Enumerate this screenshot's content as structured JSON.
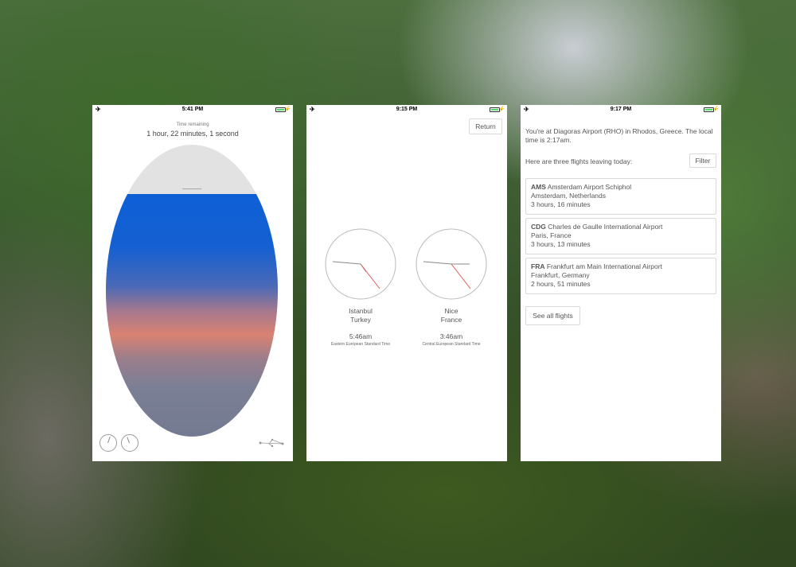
{
  "phone1": {
    "status_time": "5:41 PM",
    "time_remaining_label": "Time remaining",
    "time_remaining_value": "1 hour, 22 minutes, 1 second",
    "progress_fraction": 0.83,
    "icons": [
      "airplane-icon",
      "battery-icon",
      "clock-icon",
      "clock-icon",
      "network-icon"
    ]
  },
  "phone2": {
    "status_time": "9:15 PM",
    "return_label": "Return",
    "clocks": [
      {
        "city": "Istanbul",
        "country": "Turkey",
        "time": "5:46am",
        "timezone": "Eastern European Standard Time"
      },
      {
        "city": "Nice",
        "country": "France",
        "time": "3:46am",
        "timezone": "Central European Standard Time"
      }
    ]
  },
  "phone3": {
    "status_time": "9:17 PM",
    "intro": "You're at Diagoras Airport (RHO) in Rhodos, Greece. The local time is 2:17am.",
    "flights_label": "Here are three flights leaving today:",
    "filter_label": "Filter",
    "flights": [
      {
        "code": "AMS",
        "airport": "Amsterdam Airport Schiphol",
        "location": "Amsterdam, Netherlands",
        "duration": "3 hours, 16 minutes"
      },
      {
        "code": "CDG",
        "airport": "Charles de Gaulle International Airport",
        "location": "Paris, France",
        "duration": "3 hours, 13 minutes"
      },
      {
        "code": "FRA",
        "airport": "Frankfurt am Main International Airport",
        "location": "Frankfurt, Germany",
        "duration": "2 hours, 51 minutes"
      }
    ],
    "see_all_label": "See all flights"
  },
  "colors": {
    "accent_blue": "#0e5fd6",
    "battery_green": "#4cd964",
    "second_hand": "#e05a5a"
  }
}
